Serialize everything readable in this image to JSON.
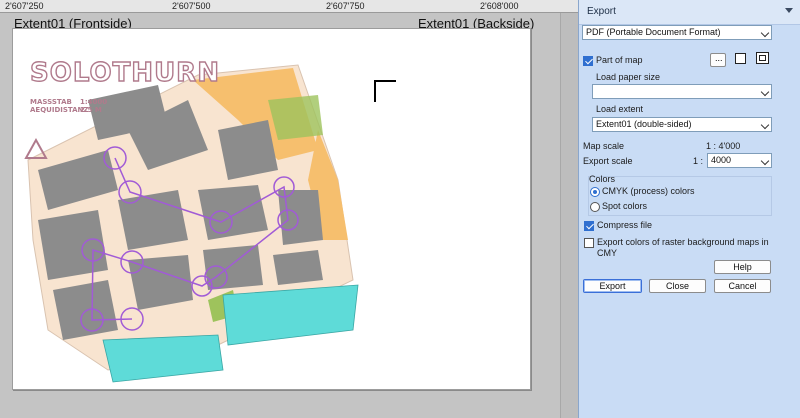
{
  "ruler": {
    "ticks": [
      "2'607'250",
      "2'607'500",
      "2'607'750",
      "2'608'000"
    ]
  },
  "canvas": {
    "front_label": "Extent01 (Frontside)",
    "back_label": "Extent01 (Backside)",
    "map": {
      "title": "SOLOTHURN",
      "scale_label": "MASSSTAB",
      "scale_value": "1:4000",
      "contour_label": "AEQUIDISTANZ",
      "contour_value": "2.5 M",
      "colors": {
        "water": "#5edbd8",
        "building": "#8c8c8c",
        "open": "#f7c27a",
        "vegetation": "#9ec35c",
        "purple": "#a15bd6"
      }
    }
  },
  "dialog": {
    "title": "Export",
    "format": "PDF (Portable Document Format)",
    "part_of_map_label": "Part of map",
    "part_of_map_checked": true,
    "more_button": "...",
    "load_paper_size_label": "Load paper size",
    "paper_size_value": "",
    "load_extent_label": "Load extent",
    "extent_value": "Extent01 (double-sided)",
    "map_scale_label": "Map scale",
    "map_scale_value": "1 : 4'000",
    "export_scale_label": "Export scale",
    "export_scale_prefix": "1 :",
    "export_scale_value": "4000",
    "colors_label": "Colors",
    "cmyk_label": "CMYK (process) colors",
    "spot_label": "Spot colors",
    "cmyk_selected": true,
    "compress_label": "Compress file",
    "compress_checked": true,
    "raster_label": "Export colors of raster background maps in CMY",
    "raster_checked": false,
    "help_button": "Help",
    "export_button": "Export",
    "close_button": "Close",
    "cancel_button": "Cancel"
  }
}
